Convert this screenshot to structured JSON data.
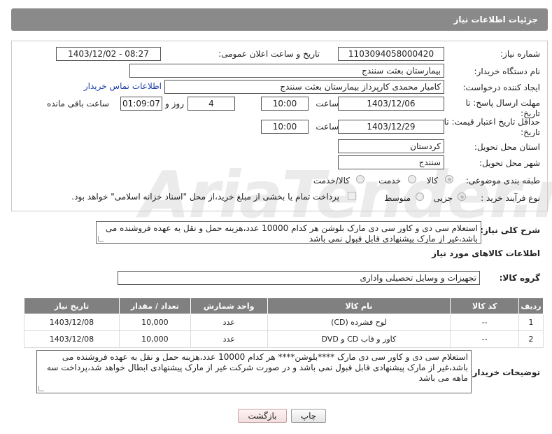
{
  "header": {
    "title": "جزئیات اطلاعات نیاز"
  },
  "form": {
    "need_number": {
      "label": "شماره نیاز:",
      "value": "1103094058000420"
    },
    "announce_datetime": {
      "label": "تاریخ و ساعت اعلان عمومی:",
      "value": "1403/12/02 - 08:27"
    },
    "buyer_org": {
      "label": "نام دستگاه خریدار:",
      "value": "بیمارستان بعثت سنندج"
    },
    "requester": {
      "label": "ایجاد کننده درخواست:",
      "value": "کامیار محمدی کارپرداز بیمارستان بعثت سنندج",
      "contact_link": "اطلاعات تماس خریدار"
    },
    "reply_deadline": {
      "label": "مهلت ارسال پاسخ: تا تاریخ:",
      "date": "1403/12/06",
      "time_label": "ساعت",
      "time": "10:00",
      "days": "4",
      "days_label": "روز و",
      "remaining": "01:09:07",
      "remaining_label": "ساعت باقی مانده"
    },
    "price_validity": {
      "label": "حداقل تاریخ اعتبار قیمت: تا تاریخ:",
      "date": "1403/12/29",
      "time_label": "ساعت",
      "time": "10:00"
    },
    "province": {
      "label": "استان محل تحویل:",
      "value": "کردستان"
    },
    "city": {
      "label": "شهر محل تحویل:",
      "value": "سنندج"
    },
    "category": {
      "label": "طبقه بندی موضوعی:",
      "options": [
        "کالا",
        "خدمت",
        "کالا/خدمت"
      ]
    },
    "process_type": {
      "label": "نوع فرآیند خرید :",
      "options": [
        "جزیی",
        "متوسط"
      ],
      "payment_note": "پرداخت تمام یا بخشی از مبلغ خرید،از محل \"اسناد خزانه اسلامی\" خواهد بود."
    }
  },
  "description": {
    "label": "شرح کلی نیاز:",
    "text": "استعلام سی دی و کاور سی دی مارک بلوشن هر کدام 10000 عدد،هزینه حمل و نقل به عهده فروشنده  می باشد،غیر از مارک پیشنهادی قابل قبول نمی باشد"
  },
  "goods_section": {
    "title": "اطلاعات کالاهای مورد نیاز",
    "group_label": "گروه کالا:",
    "group_value": "تجهیزات و وسایل تحصیلی واداری"
  },
  "table": {
    "headers": [
      "ردیف",
      "کد کالا",
      "نام کالا",
      "واحد شمارش",
      "تعداد / مقدار",
      "تاریخ نیاز"
    ],
    "rows": [
      [
        "1",
        "--",
        "لوح فشرده (CD)",
        "عدد",
        "10,000",
        "1403/12/08"
      ],
      [
        "2",
        "--",
        "کاور و قاب CD و DVD",
        "عدد",
        "10,000",
        "1403/12/08"
      ]
    ]
  },
  "buyer_notes": {
    "label": "توضیحات خریدار:",
    "text": "استعلام سی دی و کاور سی دی مارک ****بلوشن****  هر کدام 10000 عدد،هزینه حمل و نقل به عهده فروشنده  می باشد،غیر از مارک پیشنهادی قابل قبول نمی باشد و در صورت شرکت غیر از مارک پیشنهادی ابطال خواهد شد،پرداخت سه ماهه می باشد"
  },
  "buttons": {
    "print": "چاپ",
    "back": "بازگشت"
  },
  "watermark": {
    "text": "AriaTender.neT"
  }
}
